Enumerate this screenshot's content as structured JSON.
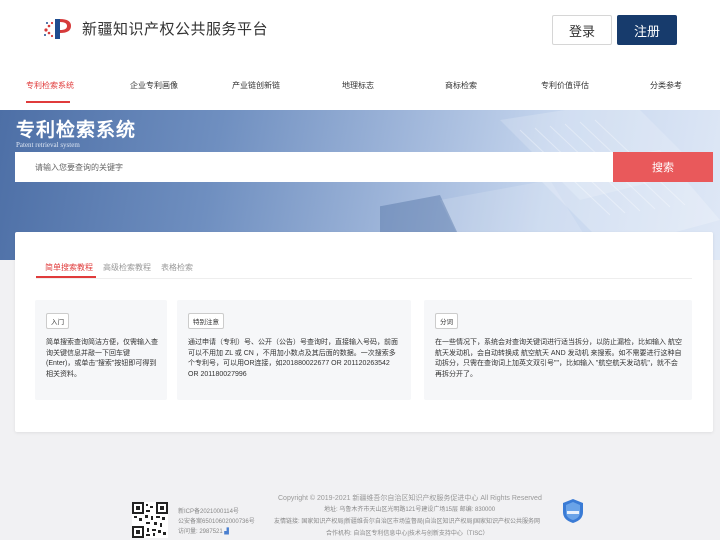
{
  "header": {
    "site_title": "新疆知识产权公共服务平台",
    "login_label": "登录",
    "register_label": "注册"
  },
  "nav": {
    "items": [
      {
        "label": "专利检索系统",
        "active": true
      },
      {
        "label": "企业专利画像"
      },
      {
        "label": "产业链创新链"
      },
      {
        "label": "地理标志"
      },
      {
        "label": "商标检索"
      },
      {
        "label": "专利价值评估"
      },
      {
        "label": "分类参考"
      }
    ]
  },
  "banner": {
    "title": "专利检索系统",
    "subtitle": "Patent retrieval system",
    "search_placeholder": "请输入您要查询的关键字",
    "search_button": "搜索"
  },
  "tabs": [
    {
      "label": "简单搜索教程",
      "active": true
    },
    {
      "label": "高级检索教程"
    },
    {
      "label": "表格检索"
    }
  ],
  "panels": [
    {
      "tag": "入门",
      "text": "简单搜索查询简洁方便，仅需输入查询关键信息并敲一下回车键(Enter)，或单击\"搜索\"按钮即可得到相关资料。"
    },
    {
      "tag": "特别注意",
      "text": "通过申请（专利）号、公开（公告）号查询时，直接输入号码，前面可以不用加 ZL 或 CN ，不用加小数点及其后面的数据。一次搜索多个专利号，可以用OR连接，如201880022677 OR 201120263542 OR 201180027996"
    },
    {
      "tag": "分词",
      "text": "在一些情况下，系统会对查询关键词进行适当拆分，以防止漏检，比如输入 航空航天发动机，会自动转换成 航空航天 AND 发动机 来搜索。如不需要进行这种自动拆分，只需在查询词上加英文双引号\"\"，比如输入 \"航空航天发动机\"，就不会再拆分开了。"
    }
  ],
  "footer": {
    "copyright": "Copyright © 2019-2021 新疆维吾尔自治区知识产权服务促进中心 All Rights Reserved",
    "icp": "新ICP备2021000114号",
    "police": "公安备案65010602000736号",
    "visits_label": "访问量:",
    "visits": "2987521",
    "address": "地址: 乌鲁木齐市天山区光明路121号建设广场15层 邮编: 830000",
    "links": "友情链接: 国家知识产权局|新疆维吾尔自治区市场监督局|自治区知识产权局|国家知识产权公共服务网",
    "partners": "合作机构: 自治区专利信息中心|技术与创新支持中心（TISC）"
  },
  "colors": {
    "accent_red": "#e03b3b",
    "primary_blue": "#173b6c",
    "search_red": "#e9595b"
  }
}
